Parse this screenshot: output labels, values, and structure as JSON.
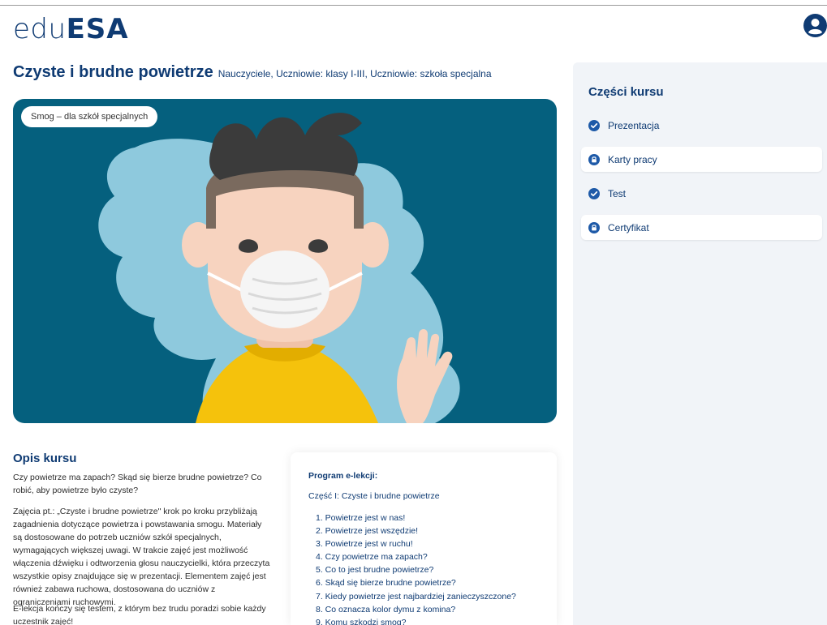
{
  "header": {
    "logo_light": "edu",
    "logo_bold": "ESA",
    "user_icon": "user-circle-icon"
  },
  "course": {
    "title": "Czyste i brudne powietrze",
    "audience": "Nauczyciele, Uczniowie: klasy I-III, Uczniowie: szkoła specjalna",
    "hero_badge": "Smog – dla szkół specjalnych"
  },
  "sidebar": {
    "title": "Części kursu",
    "parts": [
      {
        "label": "Prezentacja",
        "status": "completed",
        "icon": "check-circle-icon"
      },
      {
        "label": "Karty pracy",
        "status": "locked",
        "icon": "lock-icon"
      },
      {
        "label": "Test",
        "status": "completed",
        "icon": "check-circle-icon"
      },
      {
        "label": "Certyfikat",
        "status": "locked",
        "icon": "lock-icon"
      }
    ]
  },
  "description": {
    "title": "Opis kursu",
    "paragraphs": [
      "Czy powietrze ma zapach? Skąd się bierze brudne powietrze? Co robić, aby powietrze było czyste?",
      "Zajęcia pt.: „Czyste i brudne powietrze\" krok po kroku przybliżają zagadnienia dotyczące powietrza i powstawania smogu. Materiały są dostosowane do potrzeb uczniów szkół specjalnych, wymagających większej uwagi. W trakcie zajęć jest możliwość włączenia dźwięku i odtworzenia głosu nauczycielki, która przeczyta wszystkie opisy znajdujące się w prezentacji.  Elementem zajęć jest również zabawa ruchowa, dostosowana do uczniów z ograniczeniami ruchowymi.",
      "E-lekcja kończy się testem, z którym bez trudu poradzi sobie każdy uczestnik zajęć!"
    ]
  },
  "program": {
    "title": "Program e-lekcji:",
    "part_label": "Część I: Czyste i brudne powietrze",
    "lessons": [
      "1. Powietrze jest w nas!",
      "2. Powietrze jest wszędzie!",
      "3. Powietrze jest w ruchu!",
      "4. Czy powietrze ma zapach?",
      "5. Co to jest brudne powietrze?",
      "6. Skąd się bierze brudne powietrze?",
      "7. Kiedy powietrze jest najbardziej zanieczyszczone?",
      "8. Co oznacza kolor dymu z komina?",
      "9. Komu szkodzi smog?"
    ]
  },
  "colors": {
    "brand": "#0f3b73",
    "hero_bg": "#05607e",
    "cloud": "#8ec9dd",
    "shirt": "#f5c20c",
    "skin": "#f7d3bf",
    "hair": "#3b3b3b"
  }
}
